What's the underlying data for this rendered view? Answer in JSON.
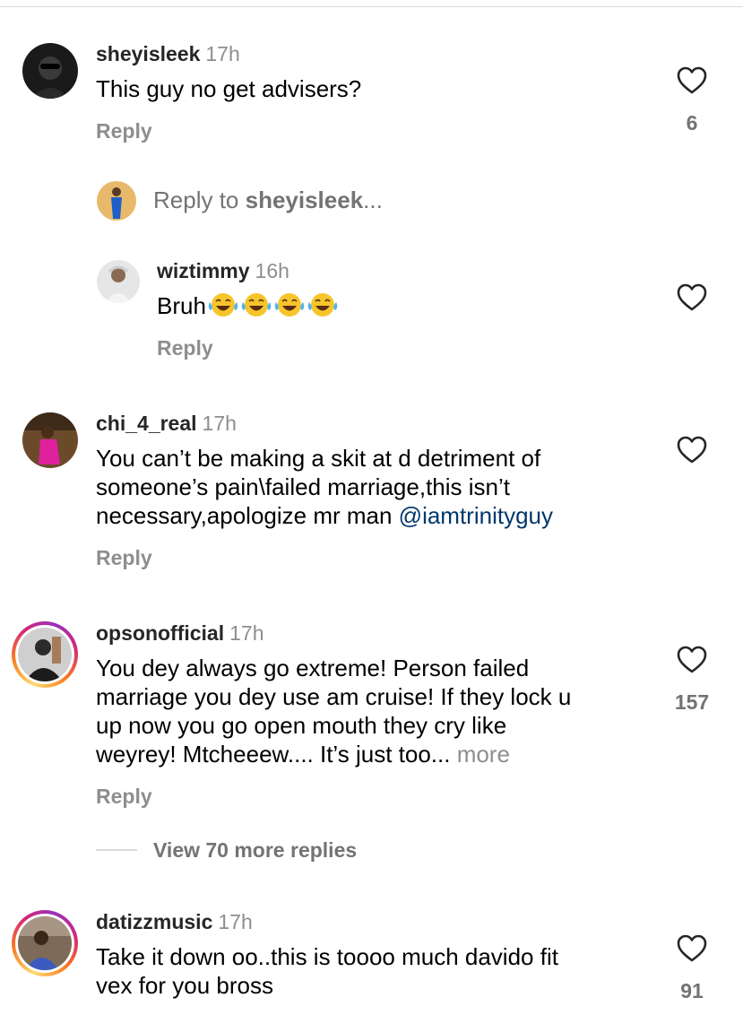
{
  "comments": [
    {
      "username": "sheyisleek",
      "time": "17h",
      "text": "This guy no get advisers?",
      "reply_label": "Reply",
      "likes": "6",
      "like_icon": "heart-outline-icon"
    },
    {
      "username": "chi_4_real",
      "time": "17h",
      "text_lines": [
        "You can’t be making a skit at d detriment of",
        "someone’s pain\\failed marriage,this isn’t",
        "necessary,apologize mr man "
      ],
      "mention": "@iamtrinityguy",
      "reply_label": "Reply"
    },
    {
      "username": "opsonofficial",
      "time": "17h",
      "text_lines": [
        "You dey always go extreme! Person failed",
        "marriage you dey use am cruise! If they lock u",
        "up now you go open mouth they cry like",
        "weyrey! Mtcheeew.... It’s just too... "
      ],
      "more_label": "more",
      "reply_label": "Reply",
      "likes": "157",
      "view_replies": "View 70 more replies"
    },
    {
      "username": "datizzmusic",
      "time": "17h",
      "text_lines": [
        "Take it down oo..this is toooo much davido fit",
        "vex for you bross"
      ],
      "likes": "91"
    }
  ],
  "reply_composer": {
    "prefix": "Reply to ",
    "target": "sheyisleek",
    "suffix": "..."
  },
  "nested_reply": {
    "username": "wiztimmy",
    "time": "16h",
    "text": "Bruh",
    "emoji_name": "face-with-tears-of-joy",
    "emoji_count": 4,
    "reply_label": "Reply"
  },
  "colors": {
    "username": "#262626",
    "secondary_text": "#8e8e8e",
    "mention": "#00376b",
    "divider": "#dbdbdb"
  }
}
